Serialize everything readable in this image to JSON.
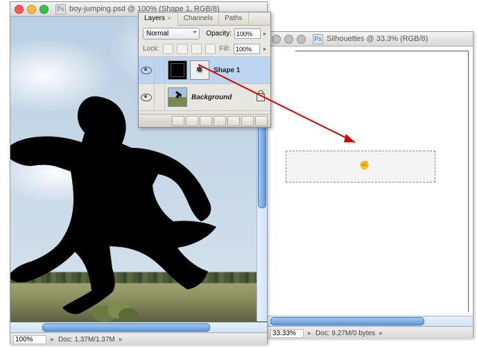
{
  "doc1": {
    "title": "boy-jumping.psd @ 100% (Shape 1, RGB/8)",
    "zoom": "100%",
    "doc_stats": "Doc: 1.37M/1.37M"
  },
  "doc2": {
    "title": "Silhouettes @ 33.3% (RGB/8)",
    "zoom": "33.33%",
    "doc_stats": "Doc: 9.27M/0 bytes"
  },
  "panel": {
    "tabs": {
      "layers": "Layers",
      "channels": "Channels",
      "paths": "Paths"
    },
    "blend_mode": "Normal",
    "opacity_label": "Opacity:",
    "opacity_value": "100%",
    "lock_label": "Lock:",
    "fill_label": "Fill:",
    "fill_value": "100%",
    "layer1": "Shape 1",
    "layer2": "Background"
  }
}
